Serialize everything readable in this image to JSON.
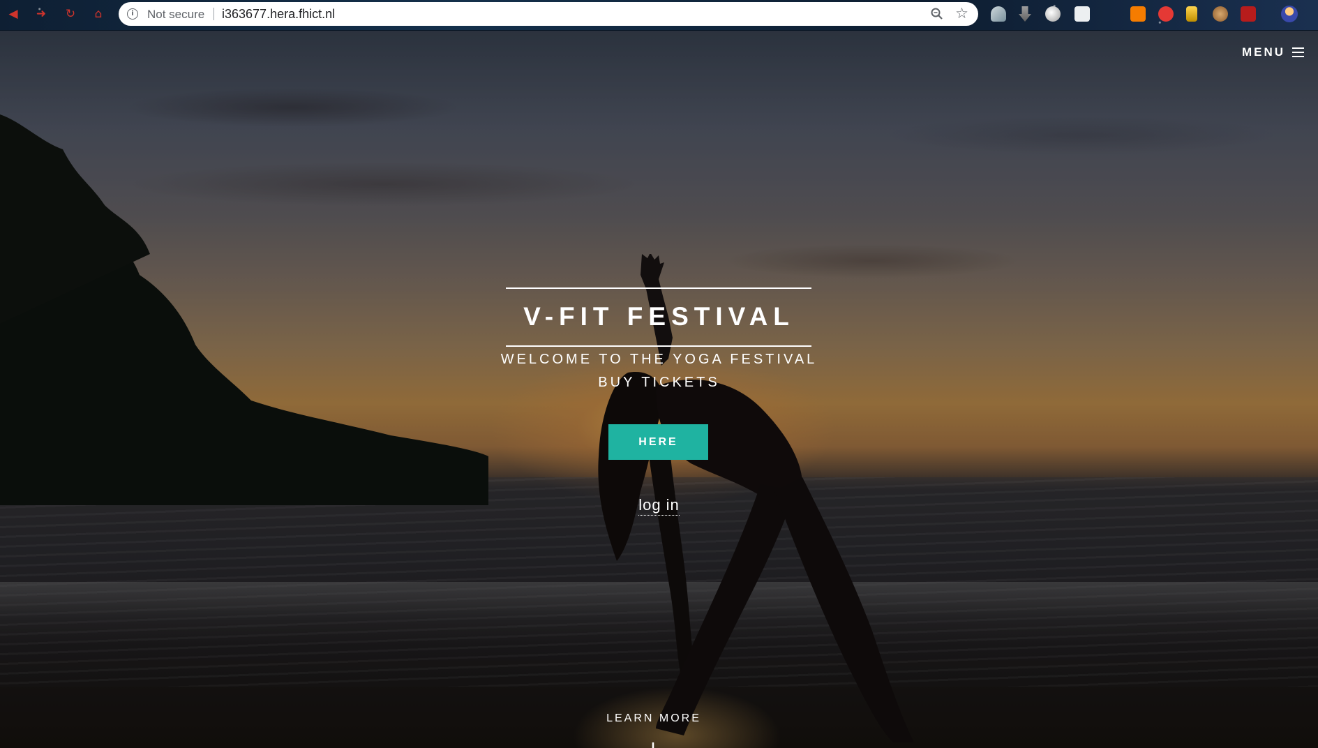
{
  "browser": {
    "security_label": "Not secure",
    "url": "i363677.hera.fhict.nl"
  },
  "page": {
    "menu_label": "MENU",
    "title": "V-FIT FESTIVAL",
    "subtitle": "WELCOME TO THE YOGA FESTIVAL",
    "tickets_label": "BUY TICKETS",
    "here_button": "HERE",
    "login_link": "log in",
    "learn_more": "LEARN MORE"
  },
  "colors": {
    "accent": "#1fb3a1",
    "nav_red": "#d0342c"
  },
  "icons": [
    "back-icon",
    "forward-icon",
    "reload-icon",
    "home-icon",
    "info-icon",
    "zoom-icon",
    "star-icon",
    "hamburger-icon",
    "arrow-down-icon"
  ]
}
